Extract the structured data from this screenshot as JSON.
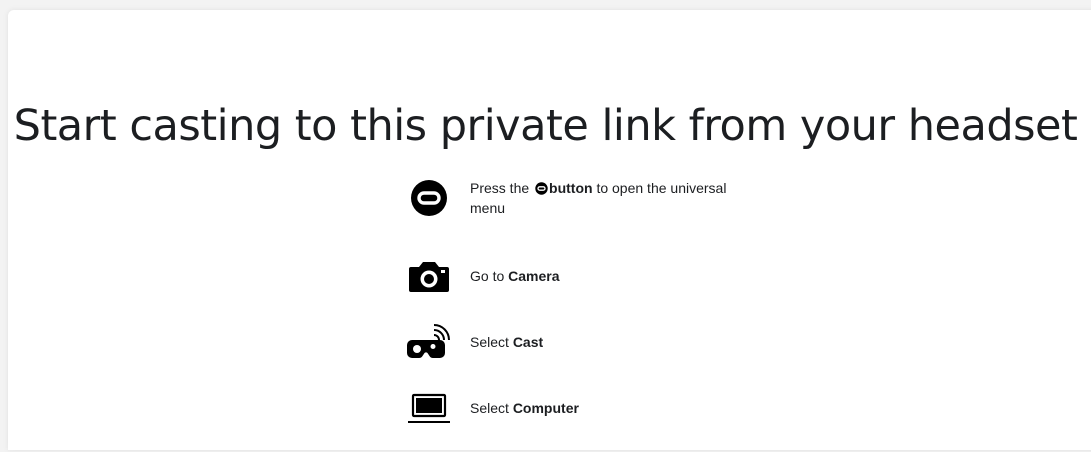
{
  "heading": "Start casting to this private link from your headset",
  "steps": [
    {
      "icon": "oculus-icon",
      "before": "Press the",
      "bold": "button",
      "after": "to open the universal menu"
    },
    {
      "icon": "camera-icon",
      "before": "Go to",
      "bold": "Camera"
    },
    {
      "icon": "cast-icon",
      "before": "Select",
      "bold": "Cast"
    },
    {
      "icon": "laptop-icon",
      "before": "Select",
      "bold": "Computer"
    }
  ]
}
